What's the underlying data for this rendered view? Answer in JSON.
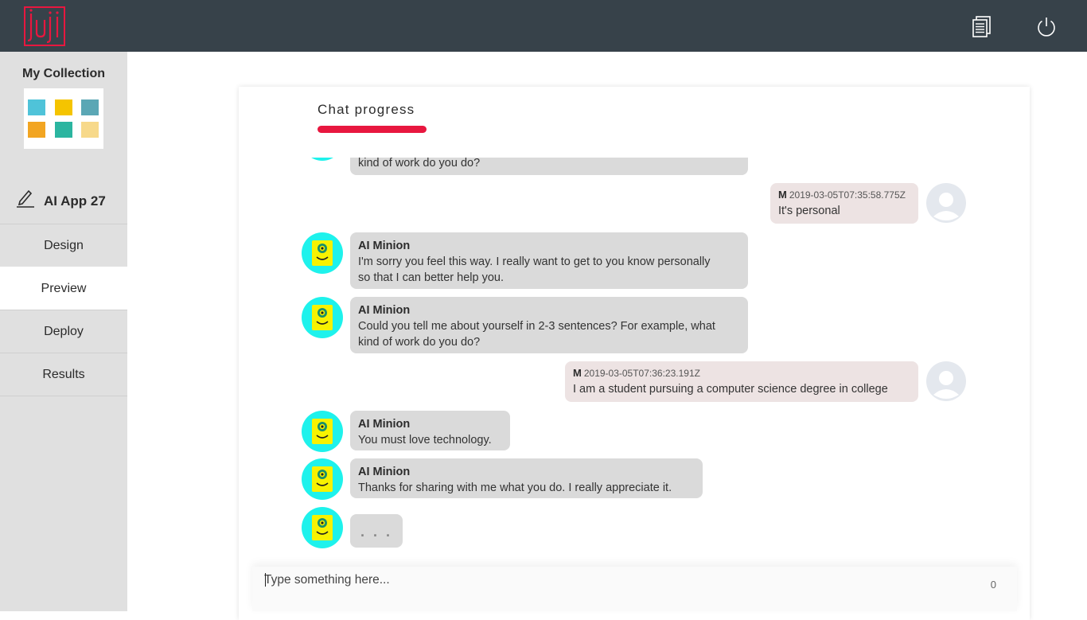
{
  "app": {
    "logo_text": "Juji",
    "brand_color": "#e8173f",
    "icons": {
      "docs": "document-list-icon",
      "power": "power-icon"
    }
  },
  "sidebar": {
    "collection_title": "My Collection",
    "app_name": "AI App 27",
    "nav": [
      {
        "label": "Design",
        "active": false
      },
      {
        "label": "Preview",
        "active": true
      },
      {
        "label": "Deploy",
        "active": false
      },
      {
        "label": "Results",
        "active": false
      }
    ]
  },
  "chat": {
    "progress_label": "Chat progress",
    "progress_fraction": 1.0,
    "messages": [
      {
        "role": "bot",
        "text": "kind of work do you do?"
      },
      {
        "role": "user",
        "initial": "M",
        "timestamp": "2019-03-05T07:35:58.775Z",
        "text": "It's personal"
      },
      {
        "role": "bot",
        "sender": "AI Minion",
        "text_lines": [
          "I'm sorry you feel this way. I really want to get to you know personally",
          "so that I can better help you."
        ]
      },
      {
        "role": "bot",
        "sender": "AI Minion",
        "text_lines": [
          "Could you tell me about yourself in 2-3 sentences? For example, what",
          "kind of work do you do?"
        ]
      },
      {
        "role": "user",
        "initial": "M",
        "timestamp": "2019-03-05T07:36:23.191Z",
        "text": "I am a student pursuing a computer science degree in college"
      },
      {
        "role": "bot",
        "sender": "AI Minion",
        "text": "You must love technology."
      },
      {
        "role": "bot",
        "sender": "AI Minion",
        "text": "Thanks for sharing with me what you do. I really appreciate it."
      },
      {
        "role": "bot",
        "typing": ". . ."
      }
    ]
  },
  "input": {
    "placeholder": "Type something here...",
    "char_count": "0"
  }
}
